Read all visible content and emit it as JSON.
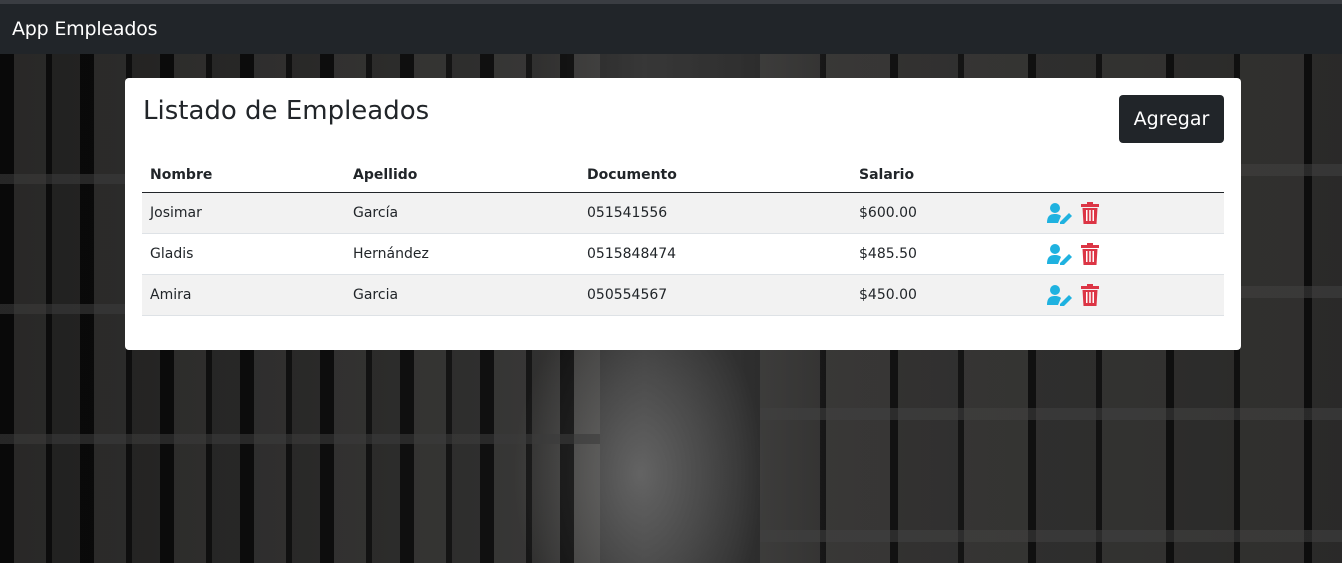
{
  "navbar": {
    "brand": "App Empleados"
  },
  "card": {
    "title": "Listado de Empleados",
    "add_label": "Agregar"
  },
  "table": {
    "headers": [
      "Nombre",
      "Apellido",
      "Documento",
      "Salario",
      ""
    ],
    "rows": [
      {
        "nombre": "Josimar",
        "apellido": "García",
        "documento": "051541556",
        "salario": "$600.00"
      },
      {
        "nombre": "Gladis",
        "apellido": "Hernández",
        "documento": "0515848474",
        "salario": "$485.50"
      },
      {
        "nombre": "Amira",
        "apellido": "Garcia",
        "documento": "050554567",
        "salario": "$450.00"
      }
    ]
  },
  "icons": {
    "edit": "user-edit-icon",
    "delete": "trash-icon"
  },
  "colors": {
    "navbar": "#212529",
    "edit_icon": "#1fb2e0",
    "delete_icon": "#dc3545",
    "row_stripe": "#f2f2f2"
  }
}
